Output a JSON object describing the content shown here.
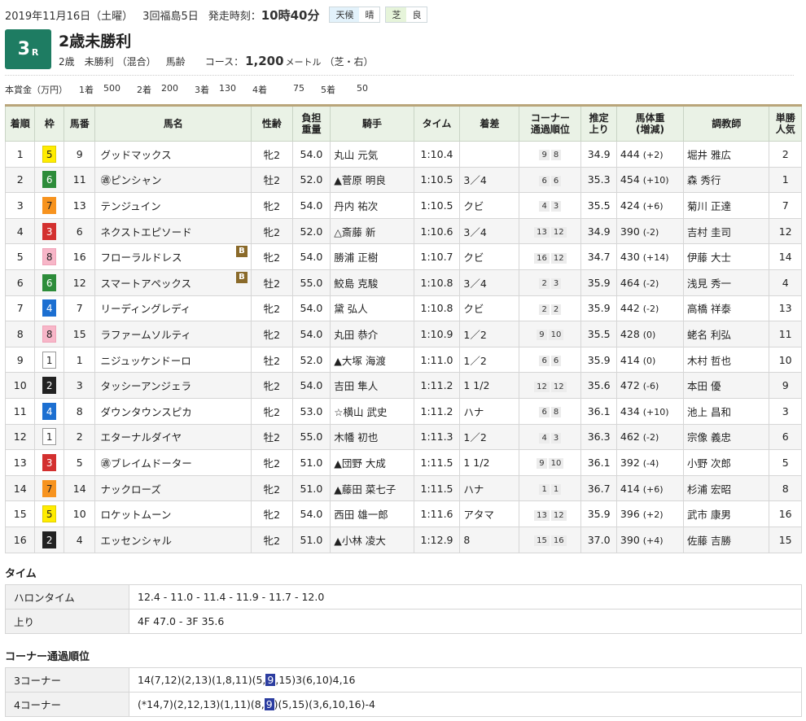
{
  "header": {
    "date": "2019年11月16日（土曜）",
    "meeting": "3回福島5日",
    "start_label": "発走時刻：",
    "start_time": "10時40分",
    "weather_label": "天候",
    "weather": "晴",
    "turf_label": "芝",
    "turf_condition": "良"
  },
  "race": {
    "number": "3",
    "suffix": "R",
    "name": "2歳未勝利",
    "age": "2歳",
    "class": "未勝利",
    "mixed": "（混合）",
    "weight_rule": "馬齢",
    "course_label": "コース：",
    "distance": "1,200",
    "unit": "メートル",
    "surface": "（芝・右）"
  },
  "prize": {
    "label": "本賞金（万円）",
    "items": [
      {
        "place": "1着",
        "value": "500"
      },
      {
        "place": "2着",
        "value": "200"
      },
      {
        "place": "3着",
        "value": "130"
      },
      {
        "place": "4着",
        "value": "75"
      },
      {
        "place": "5着",
        "value": "50"
      }
    ]
  },
  "table": {
    "headers": [
      "着順",
      "枠",
      "馬番",
      "馬名",
      "性齢",
      "負担\n重量",
      "騎手",
      "タイム",
      "着差",
      "コーナー\n通過順位",
      "推定\n上り",
      "馬体重\n(増減)",
      "調教師",
      "単勝\n人気"
    ],
    "rows": [
      {
        "rank": "1",
        "waku": "5",
        "num": "9",
        "name": "グッドマックス",
        "blinker": false,
        "sex": "牝2",
        "wt": "54.0",
        "jockey": "丸山 元気",
        "time": "1:10.4",
        "margin": "",
        "c1": "9",
        "c2": "8",
        "last": "34.9",
        "bw": "444",
        "bwd": "(+2)",
        "trainer": "堀井 雅広",
        "pop": "2"
      },
      {
        "rank": "2",
        "waku": "6",
        "num": "11",
        "name": "㊜ピンシャン",
        "blinker": false,
        "sex": "牡2",
        "wt": "52.0",
        "jockey": "▲菅原 明良",
        "time": "1:10.5",
        "margin": "3／4",
        "c1": "6",
        "c2": "6",
        "last": "35.3",
        "bw": "454",
        "bwd": "(+10)",
        "trainer": "森 秀行",
        "pop": "1"
      },
      {
        "rank": "3",
        "waku": "7",
        "num": "13",
        "name": "テンジュイン",
        "blinker": false,
        "sex": "牝2",
        "wt": "54.0",
        "jockey": "丹内 祐次",
        "time": "1:10.5",
        "margin": "クビ",
        "c1": "4",
        "c2": "3",
        "last": "35.5",
        "bw": "424",
        "bwd": "(+6)",
        "trainer": "菊川 正達",
        "pop": "7"
      },
      {
        "rank": "4",
        "waku": "3",
        "num": "6",
        "name": "ネクストエピソード",
        "blinker": false,
        "sex": "牝2",
        "wt": "52.0",
        "jockey": "△斎藤 新",
        "time": "1:10.6",
        "margin": "3／4",
        "c1": "13",
        "c2": "12",
        "last": "34.9",
        "bw": "390",
        "bwd": "(-2)",
        "trainer": "吉村 圭司",
        "pop": "12"
      },
      {
        "rank": "5",
        "waku": "8",
        "num": "16",
        "name": "フローラルドレス",
        "blinker": true,
        "sex": "牝2",
        "wt": "54.0",
        "jockey": "勝浦 正樹",
        "time": "1:10.7",
        "margin": "クビ",
        "c1": "16",
        "c2": "12",
        "last": "34.7",
        "bw": "430",
        "bwd": "(+14)",
        "trainer": "伊藤 大士",
        "pop": "14"
      },
      {
        "rank": "6",
        "waku": "6",
        "num": "12",
        "name": "スマートアペックス",
        "blinker": true,
        "sex": "牡2",
        "wt": "55.0",
        "jockey": "鮫島 克駿",
        "time": "1:10.8",
        "margin": "3／4",
        "c1": "2",
        "c2": "3",
        "last": "35.9",
        "bw": "464",
        "bwd": "(-2)",
        "trainer": "浅見 秀一",
        "pop": "4"
      },
      {
        "rank": "7",
        "waku": "4",
        "num": "7",
        "name": "リーディングレディ",
        "blinker": false,
        "sex": "牝2",
        "wt": "54.0",
        "jockey": "黛 弘人",
        "time": "1:10.8",
        "margin": "クビ",
        "c1": "2",
        "c2": "2",
        "last": "35.9",
        "bw": "442",
        "bwd": "(-2)",
        "trainer": "高橋 祥泰",
        "pop": "13"
      },
      {
        "rank": "8",
        "waku": "8",
        "num": "15",
        "name": "ラファームソルティ",
        "blinker": false,
        "sex": "牝2",
        "wt": "54.0",
        "jockey": "丸田 恭介",
        "time": "1:10.9",
        "margin": "1／2",
        "c1": "9",
        "c2": "10",
        "last": "35.5",
        "bw": "428",
        "bwd": "(0)",
        "trainer": "蛯名 利弘",
        "pop": "11"
      },
      {
        "rank": "9",
        "waku": "1",
        "num": "1",
        "name": "ニジュッケンドーロ",
        "blinker": false,
        "sex": "牡2",
        "wt": "52.0",
        "jockey": "▲大塚 海渡",
        "time": "1:11.0",
        "margin": "1／2",
        "c1": "6",
        "c2": "6",
        "last": "35.9",
        "bw": "414",
        "bwd": "(0)",
        "trainer": "木村 哲也",
        "pop": "10"
      },
      {
        "rank": "10",
        "waku": "2",
        "num": "3",
        "name": "タッシーアンジェラ",
        "blinker": false,
        "sex": "牝2",
        "wt": "54.0",
        "jockey": "吉田 隼人",
        "time": "1:11.2",
        "margin": "1 1/2",
        "c1": "12",
        "c2": "12",
        "last": "35.6",
        "bw": "472",
        "bwd": "(-6)",
        "trainer": "本田 優",
        "pop": "9"
      },
      {
        "rank": "11",
        "waku": "4",
        "num": "8",
        "name": "ダウンタウンスピカ",
        "blinker": false,
        "sex": "牝2",
        "wt": "53.0",
        "jockey": "☆横山 武史",
        "time": "1:11.2",
        "margin": "ハナ",
        "c1": "6",
        "c2": "8",
        "last": "36.1",
        "bw": "434",
        "bwd": "(+10)",
        "trainer": "池上 昌和",
        "pop": "3"
      },
      {
        "rank": "12",
        "waku": "1",
        "num": "2",
        "name": "エターナルダイヤ",
        "blinker": false,
        "sex": "牡2",
        "wt": "55.0",
        "jockey": "木幡 初也",
        "time": "1:11.3",
        "margin": "1／2",
        "c1": "4",
        "c2": "3",
        "last": "36.3",
        "bw": "462",
        "bwd": "(-2)",
        "trainer": "宗像 義忠",
        "pop": "6"
      },
      {
        "rank": "13",
        "waku": "3",
        "num": "5",
        "name": "㊜ブレイムドーター",
        "blinker": false,
        "sex": "牝2",
        "wt": "51.0",
        "jockey": "▲団野 大成",
        "time": "1:11.5",
        "margin": "1 1/2",
        "c1": "9",
        "c2": "10",
        "last": "36.1",
        "bw": "392",
        "bwd": "(-4)",
        "trainer": "小野 次郎",
        "pop": "5"
      },
      {
        "rank": "14",
        "waku": "7",
        "num": "14",
        "name": "ナックローズ",
        "blinker": false,
        "sex": "牝2",
        "wt": "51.0",
        "jockey": "▲藤田 菜七子",
        "time": "1:11.5",
        "margin": "ハナ",
        "c1": "1",
        "c2": "1",
        "last": "36.7",
        "bw": "414",
        "bwd": "(+6)",
        "trainer": "杉浦 宏昭",
        "pop": "8"
      },
      {
        "rank": "15",
        "waku": "5",
        "num": "10",
        "name": "ロケットムーン",
        "blinker": false,
        "sex": "牝2",
        "wt": "54.0",
        "jockey": "西田 雄一郎",
        "time": "1:11.6",
        "margin": "アタマ",
        "c1": "13",
        "c2": "12",
        "last": "35.9",
        "bw": "396",
        "bwd": "(+2)",
        "trainer": "武市 康男",
        "pop": "16"
      },
      {
        "rank": "16",
        "waku": "2",
        "num": "4",
        "name": "エッセンシャル",
        "blinker": false,
        "sex": "牝2",
        "wt": "51.0",
        "jockey": "▲小林 凌大",
        "time": "1:12.9",
        "margin": "8",
        "c1": "15",
        "c2": "16",
        "last": "37.0",
        "bw": "390",
        "bwd": "(+4)",
        "trainer": "佐藤 吉勝",
        "pop": "15"
      }
    ]
  },
  "blinker_mark": "B",
  "waku_colors": {
    "1": {
      "bg": "#ffffff",
      "fg": "#222222",
      "border": "#999999"
    },
    "2": {
      "bg": "#222222",
      "fg": "#ffffff",
      "border": "#222222"
    },
    "3": {
      "bg": "#d3302f",
      "fg": "#ffffff",
      "border": "#d3302f"
    },
    "4": {
      "bg": "#1c6fd1",
      "fg": "#ffffff",
      "border": "#1c6fd1"
    },
    "5": {
      "bg": "#ffec00",
      "fg": "#222222",
      "border": "#e0cf00"
    },
    "6": {
      "bg": "#2d8c3a",
      "fg": "#ffffff",
      "border": "#2d8c3a"
    },
    "7": {
      "bg": "#f7931e",
      "fg": "#222222",
      "border": "#f7931e"
    },
    "8": {
      "bg": "#f7b6c8",
      "fg": "#222222",
      "border": "#f0a2b8"
    }
  },
  "time_section": {
    "title": "タイム",
    "rows": [
      {
        "label": "ハロンタイム",
        "value": "12.4 - 11.0 - 11.4 - 11.9 - 11.7 - 12.0"
      },
      {
        "label": "上り",
        "value": "4F 47.0 - 3F 35.6"
      }
    ]
  },
  "corner_section": {
    "title": "コーナー通過順位",
    "rows": [
      {
        "label": "3コーナー",
        "pre": "14(7,12)(2,13)(1,8,11)(5,",
        "hl": "9",
        "post": ",15)3(6,10)4,16"
      },
      {
        "label": "4コーナー",
        "pre": "(*14,7)(2,12,13)(1,11)(8,",
        "hl": "9",
        "post": ")(5,15)(3,6,10,16)-4"
      }
    ]
  }
}
